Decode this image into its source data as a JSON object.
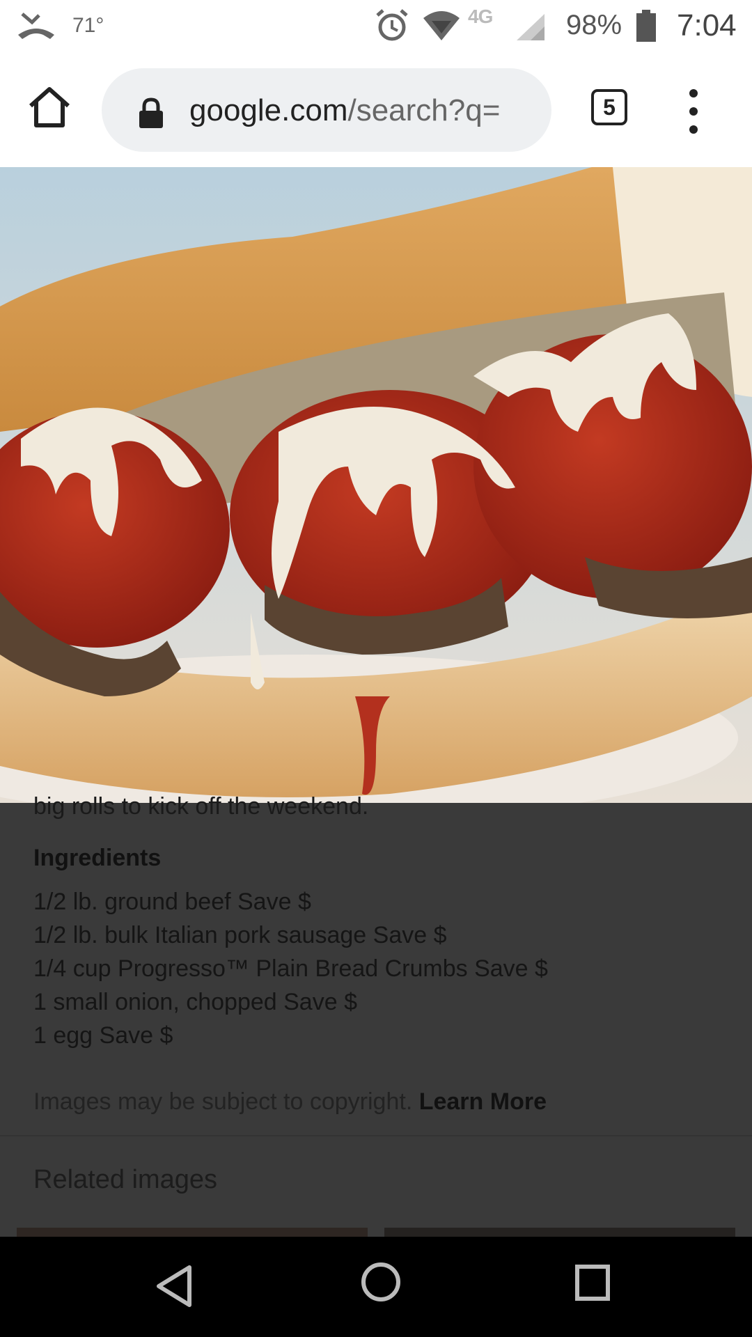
{
  "status_bar": {
    "temperature": "71°",
    "network": "4G",
    "battery_percent": "98%",
    "time": "7:04",
    "icons": [
      "missed-call-icon",
      "alarm-icon",
      "wifi-icon",
      "signal-icon",
      "battery-icon"
    ]
  },
  "browser": {
    "url_domain": "google.com",
    "url_path": "/search?q=",
    "tab_count": "5",
    "icons": [
      "home-icon",
      "lock-icon",
      "tab-switcher-icon",
      "overflow-menu-icon"
    ]
  },
  "image": {
    "subject": "meatball sub sandwich photo"
  },
  "content": {
    "lead_text": "big rolls to kick off the weekend.",
    "ingredients_heading": "Ingredients",
    "ingredients": [
      "1/2 lb. ground beef Save $",
      "1/2 lb. bulk Italian pork sausage Save $",
      "1/4 cup Progresso™ Plain Bread Crumbs Save $",
      "1 small onion, chopped Save $",
      "1 egg Save $"
    ],
    "copyright_text": "Images may be subject to copyright.",
    "learn_more": "Learn More",
    "related_heading": "Related images"
  },
  "colors": {
    "overlay": "#3a3a3a",
    "toolbar": "#ffffff",
    "omnibox": "#eef0f2",
    "navbar": "#000000"
  }
}
